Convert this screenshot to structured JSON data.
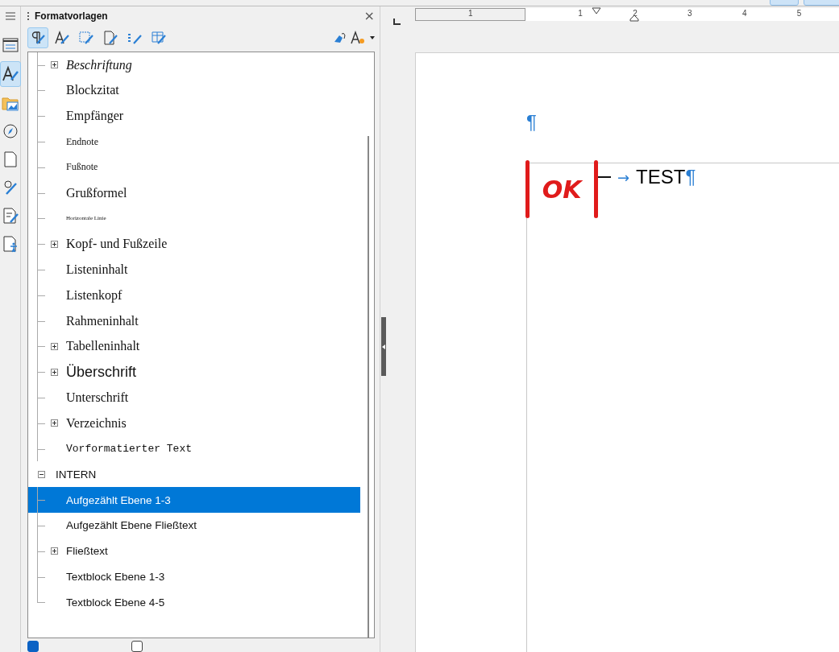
{
  "panel": {
    "title": "Formatvorlagen",
    "close": "×"
  },
  "style_types": [
    {
      "selected": true
    },
    {
      "selected": false
    },
    {
      "selected": false
    },
    {
      "selected": false
    },
    {
      "selected": false
    },
    {
      "selected": false
    }
  ],
  "side_tabs": [
    {
      "selected": false
    },
    {
      "selected": true
    },
    {
      "selected": false
    },
    {
      "selected": false
    },
    {
      "selected": false
    },
    {
      "selected": false
    },
    {
      "selected": false
    },
    {
      "selected": false
    }
  ],
  "tree": [
    {
      "children": [
        {
          "label": "Beschriftung",
          "kind": "italic",
          "expandable": true,
          "selected": false
        },
        {
          "label": "Blockzitat",
          "kind": "serif",
          "expandable": false,
          "selected": false
        },
        {
          "label": "Empfänger",
          "kind": "serif",
          "expandable": false,
          "selected": false
        },
        {
          "label": "Endnote",
          "kind": "small",
          "expandable": false,
          "selected": false
        },
        {
          "label": "Fußnote",
          "kind": "small",
          "expandable": false,
          "selected": false
        },
        {
          "label": "Grußformel",
          "kind": "serif",
          "expandable": false,
          "selected": false
        },
        {
          "label": "Horizontale Linie",
          "kind": "tiny",
          "expandable": false,
          "selected": false
        },
        {
          "label": "Kopf- und Fußzeile",
          "kind": "serif",
          "expandable": true,
          "selected": false
        },
        {
          "label": "Listeninhalt",
          "kind": "serif",
          "expandable": false,
          "selected": false
        },
        {
          "label": "Listenkopf",
          "kind": "serif",
          "expandable": false,
          "selected": false
        },
        {
          "label": "Rahmeninhalt",
          "kind": "serif",
          "expandable": false,
          "selected": false
        },
        {
          "label": "Tabelleninhalt",
          "kind": "serif",
          "expandable": true,
          "selected": false
        },
        {
          "label": "Überschrift",
          "kind": "heading",
          "expandable": true,
          "selected": false
        },
        {
          "label": "Unterschrift",
          "kind": "serif",
          "expandable": false,
          "selected": false
        },
        {
          "label": "Verzeichnis",
          "kind": "serif",
          "expandable": true,
          "selected": false
        },
        {
          "label": "Vorformatierter Text",
          "kind": "mono",
          "expandable": false,
          "selected": false
        }
      ]
    },
    {
      "label": "INTERN",
      "expanded": true,
      "children": [
        {
          "label": "Aufgezählt Ebene 1-3",
          "kind": "sans",
          "expandable": false,
          "selected": true
        },
        {
          "label": "Aufgezählt Ebene Fließtext",
          "kind": "sans",
          "expandable": false,
          "selected": false
        },
        {
          "label": "Fließtext",
          "kind": "sans",
          "expandable": true,
          "selected": false
        },
        {
          "label": "Textblock Ebene 1-3",
          "kind": "sans",
          "expandable": false,
          "selected": false
        },
        {
          "label": "Textblock Ebene 4-5",
          "kind": "sans",
          "expandable": false,
          "selected": false
        }
      ]
    }
  ],
  "options": [
    {
      "checked": true
    },
    {
      "checked": false
    }
  ],
  "ruler": {
    "labels": [
      "1",
      "1",
      "2",
      "3",
      "4",
      "5"
    ]
  },
  "document": {
    "empty_paragraph_mark": "¶",
    "annotation": "OK",
    "arrow": "→",
    "text": "TEST",
    "paragraph_mark": "¶"
  }
}
